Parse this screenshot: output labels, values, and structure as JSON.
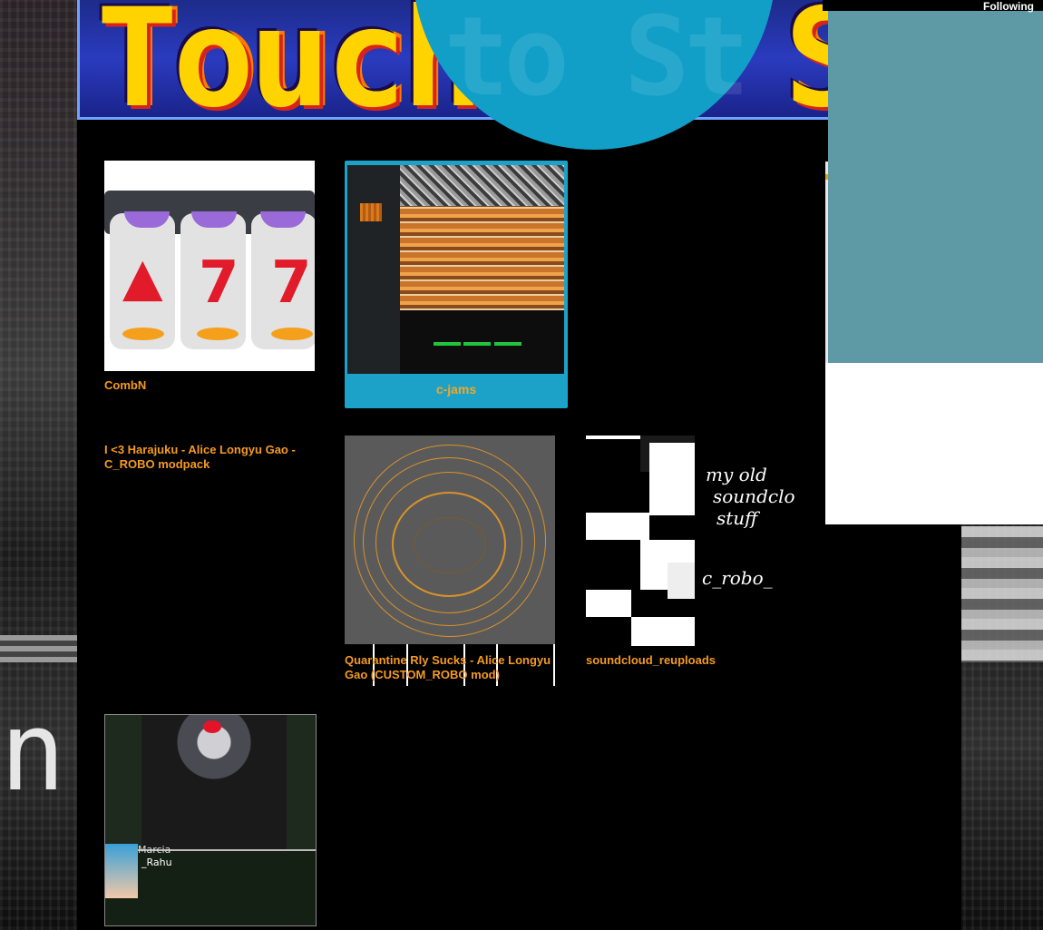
{
  "banner": {
    "title": "Touch to Start",
    "circle_watermark": "to St"
  },
  "following": {
    "label": "Following"
  },
  "cards": {
    "combn": {
      "caption": "CombN"
    },
    "cjams": {
      "caption": "c-jams"
    },
    "harajuku": {
      "caption": "I <3 Harajuku - Alice Longyu Gao - C_ROBO modpack"
    },
    "quarantine": {
      "caption": "Quarantine Rly Sucks - Alice Longyu Gao (CUSTOM_ROBO mod)"
    },
    "soundcloud": {
      "caption": "soundcloud_reuploads",
      "hand_lines": [
        "my old",
        "soundcloud",
        "stuff",
        "c_robo_"
      ]
    },
    "robo": {
      "speaker": "Marcia",
      "dialog": "_Rahu"
    }
  },
  "colors": {
    "caption": "#f59a23",
    "card_accent": "#1ca2c9",
    "following_panel": "#5e9aa6",
    "banner_circle": "#119fc8"
  }
}
